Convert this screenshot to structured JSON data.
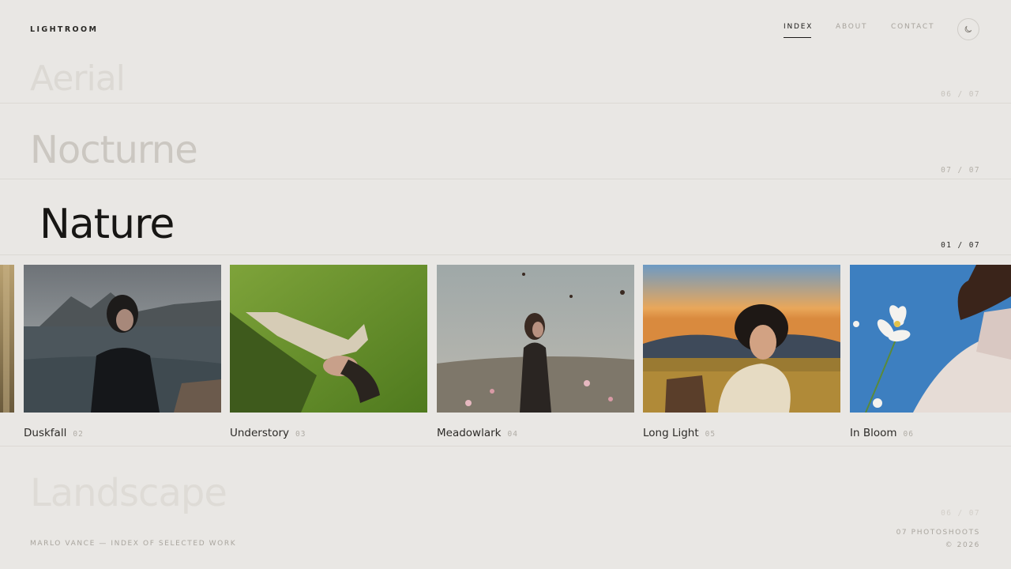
{
  "header": {
    "logo": "LIGHTROOM",
    "nav": [
      {
        "label": "INDEX",
        "active": true
      },
      {
        "label": "ABOUT",
        "active": false
      },
      {
        "label": "CONTACT",
        "active": false
      }
    ],
    "theme_icon": "moon-icon"
  },
  "rows": [
    {
      "title": "Aerial",
      "count": "06 / 07",
      "state": "faded"
    },
    {
      "title": "Nocturne",
      "count": "07 / 07",
      "state": "dim"
    },
    {
      "title": "Nature",
      "count": "01 / 07",
      "state": "active"
    },
    {
      "title": "Landscape",
      "count": "06 / 07",
      "state": "faded"
    }
  ],
  "cards": [
    {
      "title": "Duskfall",
      "num": "02"
    },
    {
      "title": "Understory",
      "num": "03"
    },
    {
      "title": "Meadowlark",
      "num": "04"
    },
    {
      "title": "Long Light",
      "num": "05"
    },
    {
      "title": "In Bloom",
      "num": "06"
    }
  ],
  "footer": {
    "left": "MARLO VANCE — INDEX OF SELECTED WORK",
    "right_line1": "07 PHOTOSHOOTS",
    "right_line2": "© 2026"
  }
}
